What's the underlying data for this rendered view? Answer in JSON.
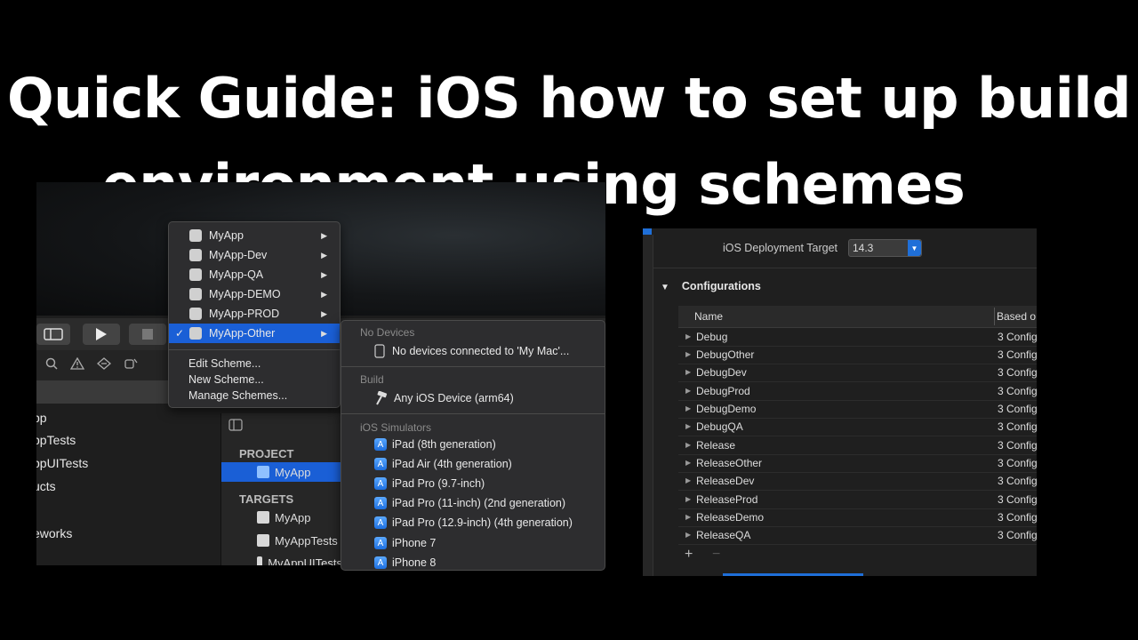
{
  "title": {
    "line1": "Quick Guide: iOS how to set up build",
    "line2": "environment using schemes"
  },
  "scheme_menu": {
    "items": [
      {
        "label": "MyApp"
      },
      {
        "label": "MyApp-Dev"
      },
      {
        "label": "MyApp-QA"
      },
      {
        "label": "MyApp-DEMO"
      },
      {
        "label": "MyApp-PROD"
      },
      {
        "label": "MyApp-Other",
        "selected": true
      }
    ],
    "check": "✓",
    "actions": [
      "Edit Scheme...",
      "New Scheme...",
      "Manage Schemes..."
    ]
  },
  "device_menu": {
    "no_devices_header": "No Devices",
    "no_devices_text": "No devices connected to 'My Mac'...",
    "build_header": "Build",
    "build_item": "Any iOS Device (arm64)",
    "simulators_header": "iOS Simulators",
    "simulators": [
      "iPad (8th generation)",
      "iPad Air (4th generation)",
      "iPad Pro (9.7-inch)",
      "iPad Pro (11-inch) (2nd generation)",
      "iPad Pro (12.9-inch) (4th generation)",
      "iPhone 7",
      "iPhone 8"
    ]
  },
  "navigator": {
    "items": [
      "pp",
      "ppTests",
      "ppUITests",
      "ucts",
      "eworks"
    ]
  },
  "project_panel": {
    "project_header": "PROJECT",
    "project_item": "MyApp",
    "targets_header": "TARGETS",
    "targets": [
      "MyApp",
      "MyAppTests",
      "MyAppUITests"
    ]
  },
  "build_settings": {
    "deployment_label": "iOS Deployment Target",
    "deployment_value": "14.3",
    "configurations_title": "Configurations",
    "col_name": "Name",
    "col_based": "Based o",
    "rows": [
      {
        "name": "Debug",
        "based": "3 Config"
      },
      {
        "name": "DebugOther",
        "based": "3 Config"
      },
      {
        "name": "DebugDev",
        "based": "3 Config"
      },
      {
        "name": "DebugProd",
        "based": "3 Config"
      },
      {
        "name": "DebugDemo",
        "based": "3 Config"
      },
      {
        "name": "DebugQA",
        "based": "3 Config"
      },
      {
        "name": "Release",
        "based": "3 Config"
      },
      {
        "name": "ReleaseOther",
        "based": "3 Config"
      },
      {
        "name": "ReleaseDev",
        "based": "3 Config"
      },
      {
        "name": "ReleaseProd",
        "based": "3 Config"
      },
      {
        "name": "ReleaseDemo",
        "based": "3 Config"
      },
      {
        "name": "ReleaseQA",
        "based": "3 Config"
      }
    ],
    "add": "+",
    "remove": "−"
  },
  "colors": {
    "accent": "#1a5fd6",
    "background": "#000000",
    "title": "#ffffff"
  }
}
